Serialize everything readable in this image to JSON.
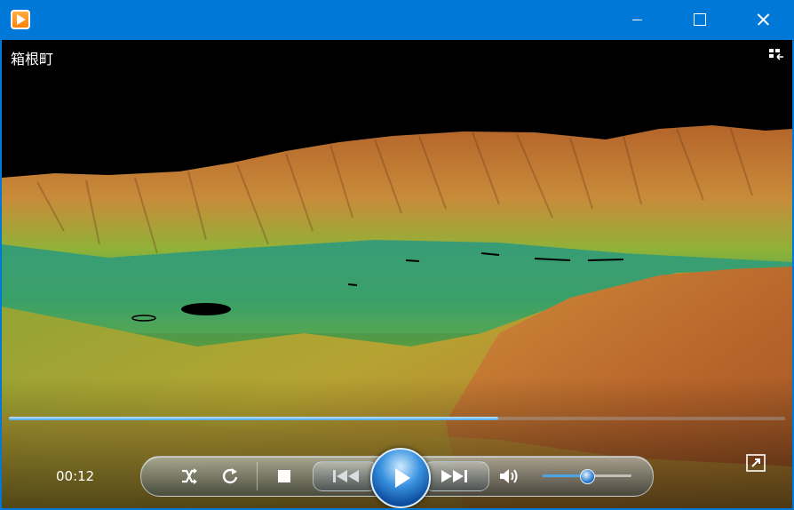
{
  "window": {
    "app_icon": "media-player-icon",
    "controls": [
      "minimize-icon",
      "maximize-icon",
      "close-icon"
    ]
  },
  "video": {
    "title": "箱根町",
    "view_switch_icon": "switch-to-library-icon"
  },
  "playback": {
    "time": "00:12",
    "progress": 0.63,
    "volume": 0.5,
    "accent_color": "#4aa4e6",
    "buttons": [
      "shuffle-icon",
      "repeat-icon",
      "stop-icon",
      "previous-icon",
      "play-icon",
      "next-icon",
      "volume-icon"
    ],
    "fullscreen_icon": "fullscreen-icon"
  },
  "colors": {
    "titlebar": "#0078d7",
    "background": "#000000"
  }
}
